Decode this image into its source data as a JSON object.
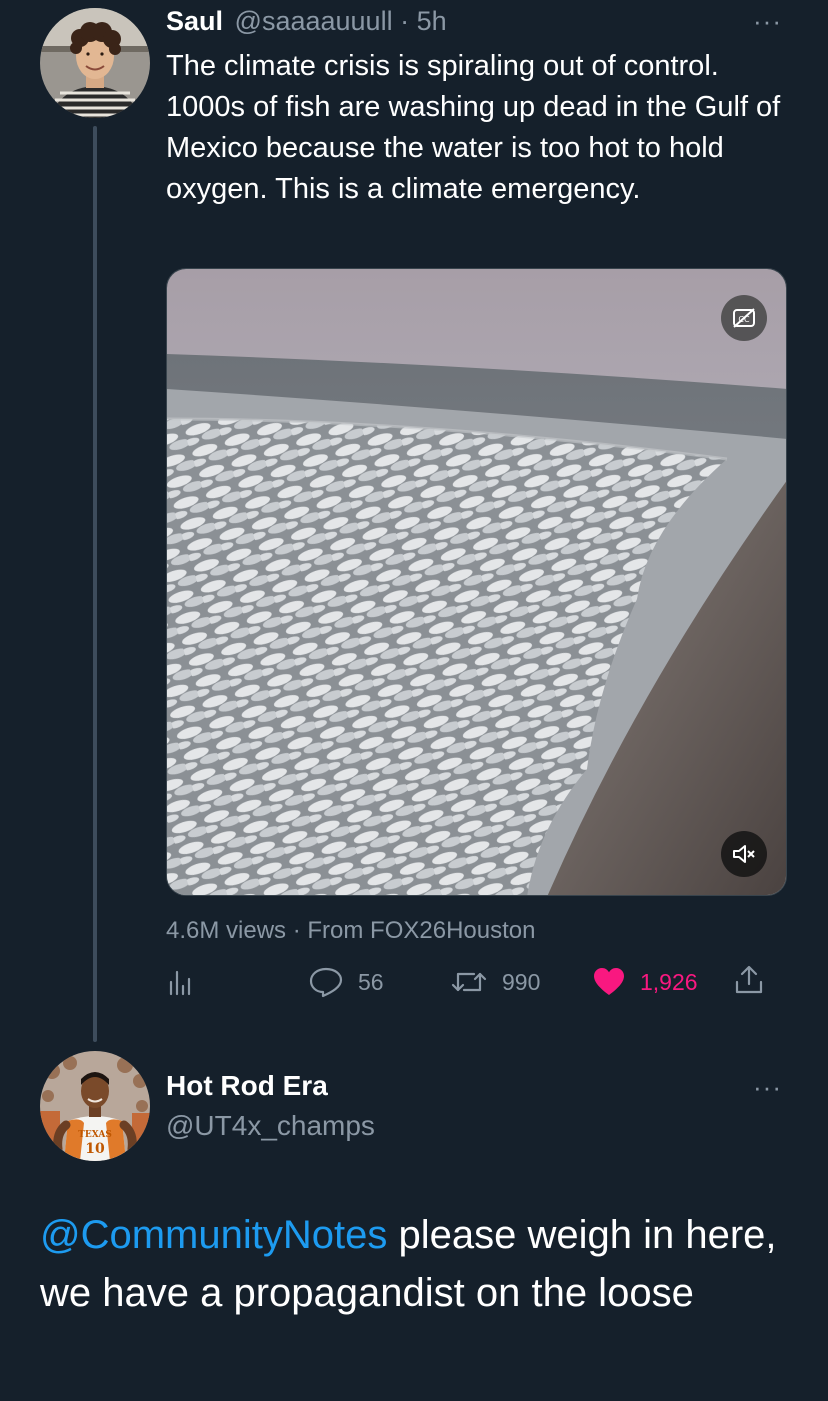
{
  "tweet": {
    "author_name": "Saul",
    "handle": "@saaaauuull",
    "separator": "·",
    "time": "5h",
    "more": "···",
    "text": "The climate crisis is spiraling out of control. 1000s of fish are washing up dead in the Gulf of Mexico because the water is too hot to hold oxygen. This is a climate emergency.",
    "media": {
      "captions_icon": "captions-off-icon",
      "mute_icon": "mute-icon"
    },
    "meta": {
      "views": "4.6M views",
      "separator": "·",
      "source": "From FOX26Houston"
    },
    "actions": {
      "analytics_icon": "analytics-icon",
      "replies": "56",
      "retweets": "990",
      "likes": "1,926",
      "share_icon": "share-icon"
    },
    "colors": {
      "like": "#f91880",
      "muted": "#8b98a5"
    }
  },
  "reply": {
    "author_name": "Hot Rod Era",
    "handle": "@UT4x_champs",
    "more": "···",
    "mention": "@CommunityNotes",
    "text": " please weigh in here, we have a propagandist on the loose",
    "avatar_jersey_text": "TEXAS",
    "avatar_jersey_number": "10",
    "colors": {
      "mention": "#1d9bf0"
    }
  }
}
